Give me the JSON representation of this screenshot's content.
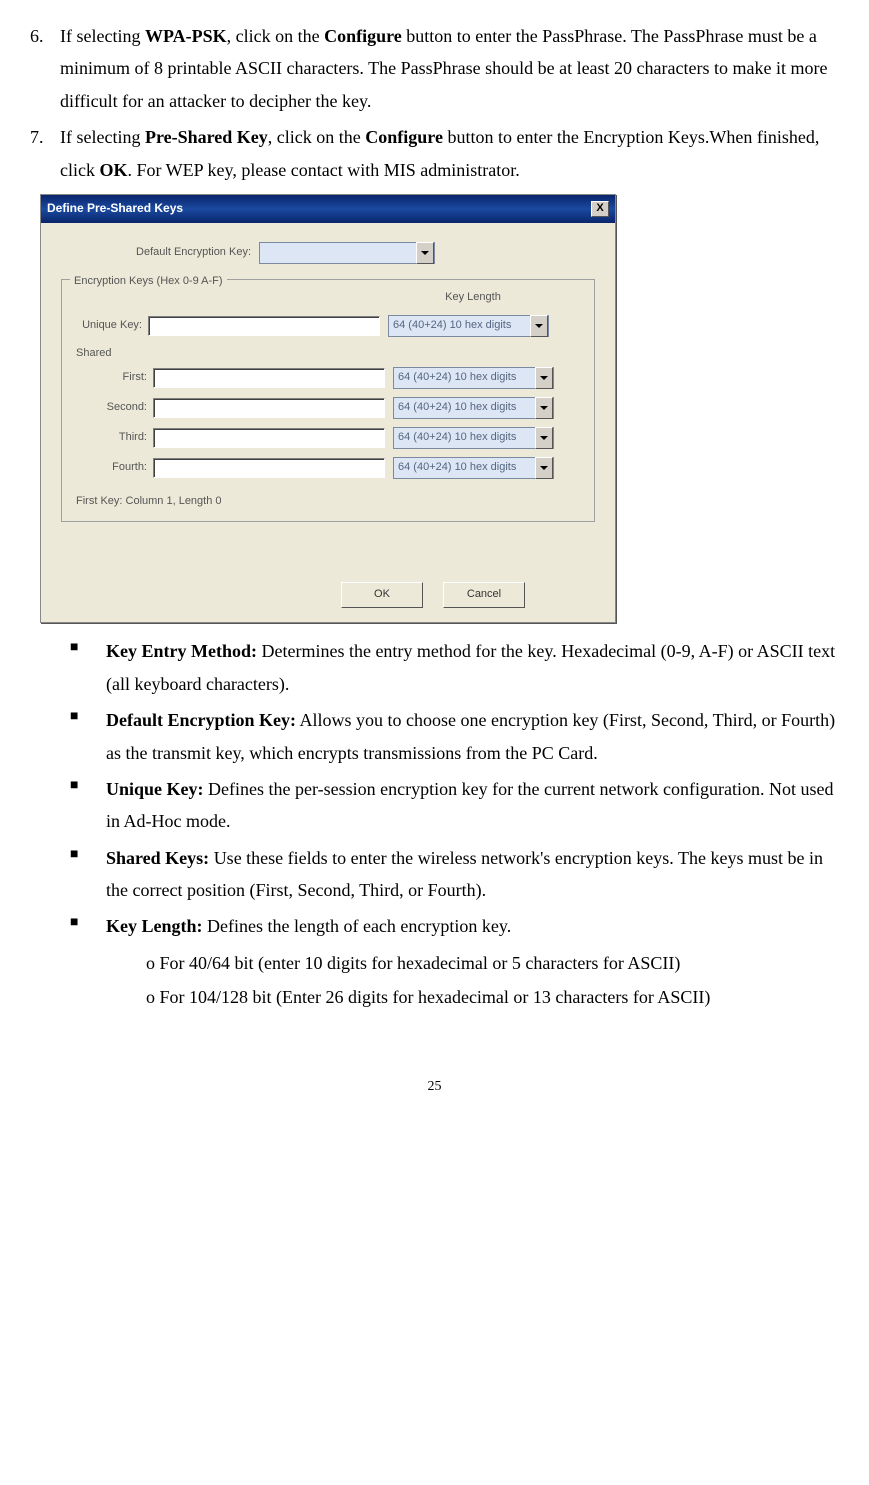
{
  "item6": {
    "num": "6.",
    "line1_a": "If selecting ",
    "line1_bold1": "WPA-PSK",
    "line1_b": ", click on the ",
    "line1_bold2": "Configure",
    "line1_c": " button to enter the PassPhrase. The PassPhrase must be a minimum of 8 printable ASCII characters. The PassPhrase should be at least 20 characters to make it more difficult for an attacker to decipher the key."
  },
  "item7": {
    "num": "7.",
    "line1_a": "If selecting ",
    "line1_bold1": "Pre-Shared Key",
    "line1_b": ", click on the ",
    "line1_bold2": "Configure",
    "line1_c": " button to enter the Encryption Keys.When finished, click ",
    "line1_bold3": "OK",
    "line1_d": ". For WEP key, please contact with MIS administrator."
  },
  "dialog": {
    "title": "Define Pre-Shared Keys",
    "close": "X",
    "default_enc_label": "Default Encryption Key:",
    "fieldset_legend": "Encryption Keys (Hex 0-9 A-F)",
    "key_length_header": "Key Length",
    "unique_key_label": "Unique Key:",
    "shared_label": "Shared",
    "first_label": "First:",
    "second_label": "Second:",
    "third_label": "Third:",
    "fourth_label": "Fourth:",
    "dropdown_value": "64  (40+24)  10 hex digits",
    "status": "First Key: Column 1,  Length 0",
    "ok": "OK",
    "cancel": "Cancel"
  },
  "bullets": {
    "b1_bold": "Key Entry Method:",
    "b1_text": " Determines the entry method for the key. Hexadecimal (0-9, A-F) or ASCII text (all keyboard characters).",
    "b2_bold": "Default Encryption Key:",
    "b2_text": " Allows you to choose one encryption key (First, Second, Third, or Fourth) as the transmit key, which encrypts transmissions from the PC Card.",
    "b3_bold": "Unique Key:",
    "b3_text": " Defines the per-session encryption key for the current network configuration. Not used in Ad-Hoc mode.",
    "b4_bold": "Shared Keys:",
    "b4_text": " Use these fields to enter the wireless network's encryption keys. The keys must be in the correct position (First, Second, Third, or Fourth).",
    "b5_bold": "Key Length:",
    "b5_text": " Defines the length of each encryption key.",
    "sub1": "o For 40/64 bit (enter 10 digits for hexadecimal or 5 characters for ASCII)",
    "sub2": "o For 104/128 bit (Enter 26 digits for hexadecimal or 13 characters for ASCII)"
  },
  "page_number": "25"
}
